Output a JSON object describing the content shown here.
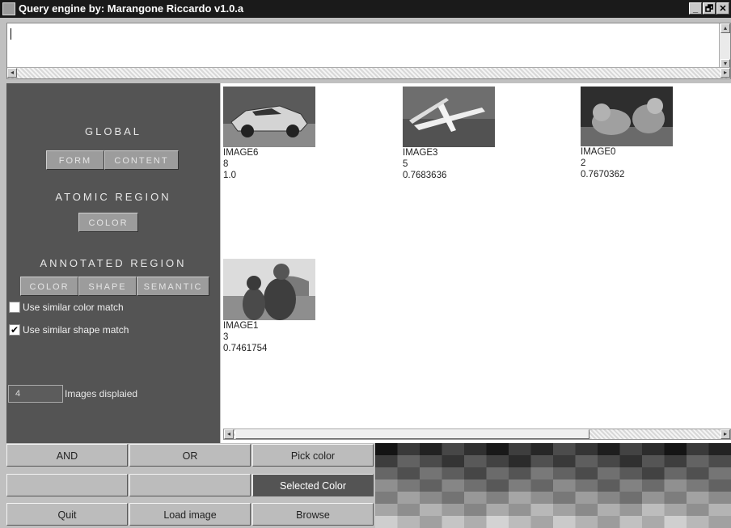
{
  "window": {
    "title": "Query engine by: Marangone Riccardo v1.0.a",
    "controls": [
      "_",
      "🗗",
      "✕"
    ]
  },
  "query_text": {
    "value": ""
  },
  "left_panel": {
    "global_heading": "GLOBAL",
    "global_buttons": [
      "FORM",
      "CONTENT"
    ],
    "atomic_heading": "ATOMIC REGION",
    "atomic_buttons": [
      "COLOR"
    ],
    "annotated_heading": "ANNOTATED REGION",
    "annotated_buttons": [
      "COLOR",
      "SHAPE",
      "SEMANTIC"
    ],
    "checkboxes": [
      {
        "label": "Use similar color match",
        "checked": false
      },
      {
        "label": "Use similar shape match",
        "checked": true
      }
    ],
    "images_count": "4",
    "images_label": "Images displaied"
  },
  "results": [
    {
      "name": "IMAGE6",
      "rank": "8",
      "score": "1.0",
      "subject": "sports-car"
    },
    {
      "name": "IMAGE3",
      "rank": "5",
      "score": "0.7683636",
      "subject": "airplane"
    },
    {
      "name": "IMAGE0",
      "rank": "2",
      "score": "0.7670362",
      "subject": "lions"
    },
    {
      "name": "IMAGE1",
      "rank": "3",
      "score": "0.7461754",
      "subject": "people"
    }
  ],
  "bottom_buttons": {
    "and": "AND",
    "or": "OR",
    "pick_color": "Pick color",
    "selected_color": "Selected Color",
    "quit": "Quit",
    "load_image": "Load image",
    "browse": "Browse"
  }
}
